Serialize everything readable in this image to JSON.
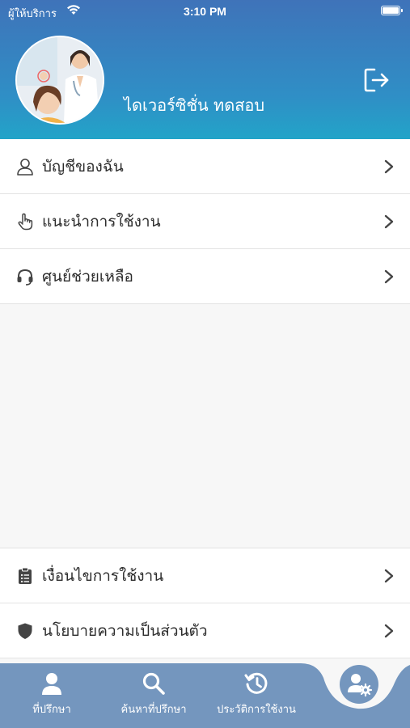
{
  "status_bar": {
    "carrier": "ผู้ให้บริการ",
    "time": "3:10 PM"
  },
  "profile": {
    "user_name": "ไดเวอร์ซิชั่น ทดสอบ",
    "avatar_icon": "doctor-photo-avatar",
    "logout_icon": "logout-icon"
  },
  "menu_top": [
    {
      "label": "บัญชีของฉัน",
      "icon": "person-icon"
    },
    {
      "label": "แนะนำการใช้งาน",
      "icon": "pointing-hand-icon"
    },
    {
      "label": "ศูนย์ช่วยเหลือ",
      "icon": "headset-icon"
    }
  ],
  "menu_bottom": [
    {
      "label": "เงื่อนไขการใช้งาน",
      "icon": "clipboard-icon"
    },
    {
      "label": "นโยบายความเป็นส่วนตัว",
      "icon": "shield-icon"
    }
  ],
  "tabs": [
    {
      "label": "ที่ปรึกษา",
      "icon": "person-icon"
    },
    {
      "label": "ค้นหาที่ปรึกษา",
      "icon": "search-icon"
    },
    {
      "label": "ประวัติการใช้งาน",
      "icon": "history-icon"
    }
  ],
  "active_tab": {
    "icon": "user-settings-icon"
  },
  "colors": {
    "header_top": "#3f73b9",
    "header_bottom": "#22a4c8",
    "tabbar": "#7496be",
    "divider": "#e3e3e3"
  }
}
